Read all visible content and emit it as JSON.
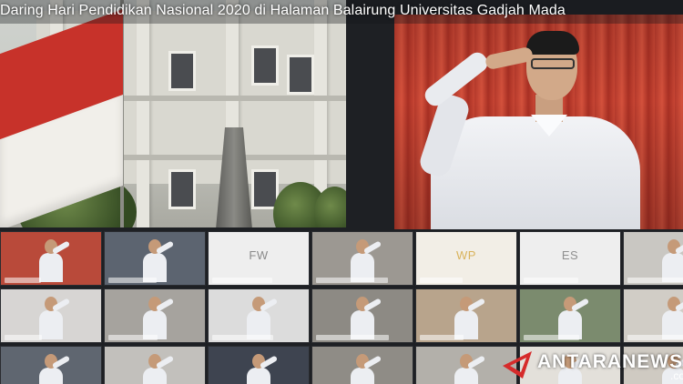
{
  "title": "Daring Hari Pendidikan Nasional 2020 di Halaman Balairung Universitas Gadjah Mada",
  "participants": [
    {
      "kind": "video",
      "bg": "#b94a3a"
    },
    {
      "kind": "video",
      "bg": "#5c6470"
    },
    {
      "kind": "avatar",
      "initials": "FW",
      "bg": "#eeeeee",
      "fg": "#8a8a8a"
    },
    {
      "kind": "video",
      "bg": "#9c9892"
    },
    {
      "kind": "avatar",
      "initials": "WP",
      "bg": "#f2eee6",
      "fg": "#d9b35c"
    },
    {
      "kind": "avatar",
      "initials": "ES",
      "bg": "#eeeeee",
      "fg": "#8f8f8f"
    },
    {
      "kind": "video",
      "bg": "#c9c7c2"
    },
    {
      "kind": "video",
      "bg": "#d7d5d3"
    },
    {
      "kind": "video",
      "bg": "#a6a39e"
    },
    {
      "kind": "video",
      "bg": "#dcdcdc"
    },
    {
      "kind": "video",
      "bg": "#8d8a84"
    },
    {
      "kind": "video",
      "bg": "#b8a48c"
    },
    {
      "kind": "video",
      "bg": "#7b8b6e"
    },
    {
      "kind": "video",
      "bg": "#d1cdc6"
    },
    {
      "kind": "video",
      "bg": "#5f6670"
    },
    {
      "kind": "video",
      "bg": "#c2c0bc"
    },
    {
      "kind": "video",
      "bg": "#3e4450"
    },
    {
      "kind": "video",
      "bg": "#8f8c86"
    },
    {
      "kind": "video",
      "bg": "#b3b0aa"
    },
    {
      "kind": "video",
      "bg": "#e3e0da"
    },
    {
      "kind": "video",
      "bg": "#cfcac2"
    }
  ],
  "watermark": {
    "brand": "ANTARANEWS",
    "suffix": ".com",
    "accent": "#d62b2b"
  }
}
